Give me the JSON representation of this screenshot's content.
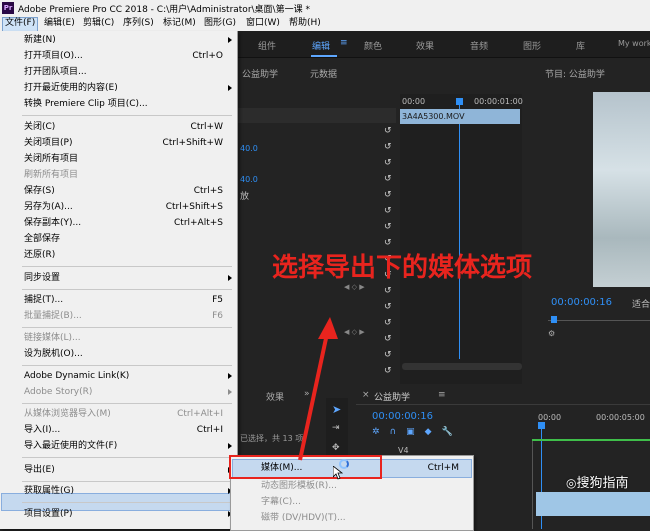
{
  "window": {
    "title": "Adobe Premiere Pro CC 2018 - C:\\用户\\Administrator\\桌面\\第一课 *",
    "app_icon": "Pr"
  },
  "menubar": [
    "文件(F)",
    "编辑(E)",
    "剪辑(C)",
    "序列(S)",
    "标记(M)",
    "图形(G)",
    "窗口(W)",
    "帮助(H)"
  ],
  "workspaces": [
    "组件",
    "编辑",
    "颜色",
    "效果",
    "音频",
    "图形",
    "库",
    "My work"
  ],
  "panels": {
    "source_tabs": [
      "公益助学",
      "元数据"
    ],
    "ec_time_start": "00:00",
    "ec_time_end": "00:00:01:00",
    "clip_name": "3A4A5300.MOV",
    "ec_values": [
      "40.0",
      "40.0"
    ],
    "ec_label_partial": "放",
    "program_title": "节目: 公益助学",
    "program_timecode": "00:00:00:16",
    "program_fit": "适合",
    "effects_tab": "效果",
    "selection_info": "已选择，共 13 项",
    "timeline_title": "公益助学",
    "timeline_timecode": "00:00:00:16",
    "timeline_ruler": [
      "00:00",
      "00:00:05:00"
    ],
    "track_label": "V4"
  },
  "file_menu": [
    {
      "label": "新建(N)",
      "arrow": true
    },
    {
      "label": "打开项目(O)...",
      "shortcut": "Ctrl+O"
    },
    {
      "label": "打开团队项目..."
    },
    {
      "label": "打开最近使用的内容(E)",
      "arrow": true
    },
    {
      "label": "转换 Premiere Clip 项目(C)..."
    },
    {
      "label": "关闭(C)",
      "shortcut": "Ctrl+W"
    },
    {
      "label": "关闭项目(P)",
      "shortcut": "Ctrl+Shift+W"
    },
    {
      "label": "关闭所有项目"
    },
    {
      "label": "刷新所有项目",
      "disabled": true
    },
    {
      "label": "保存(S)",
      "shortcut": "Ctrl+S"
    },
    {
      "label": "另存为(A)...",
      "shortcut": "Ctrl+Shift+S"
    },
    {
      "label": "保存副本(Y)...",
      "shortcut": "Ctrl+Alt+S"
    },
    {
      "label": "全部保存"
    },
    {
      "label": "还原(R)"
    },
    {
      "label": "同步设置",
      "arrow": true
    },
    {
      "label": "捕捉(T)...",
      "shortcut": "F5"
    },
    {
      "label": "批量捕捉(B)...",
      "shortcut": "F6",
      "disabled": true
    },
    {
      "label": "链接媒体(L)...",
      "disabled": true
    },
    {
      "label": "设为脱机(O)..."
    },
    {
      "label": "Adobe Dynamic Link(K)",
      "arrow": true
    },
    {
      "label": "Adobe Story(R)",
      "arrow": true,
      "disabled": true
    },
    {
      "label": "从媒体浏览器导入(M)",
      "shortcut": "Ctrl+Alt+I",
      "disabled": true
    },
    {
      "label": "导入(I)...",
      "shortcut": "Ctrl+I"
    },
    {
      "label": "导入最近使用的文件(F)",
      "arrow": true
    },
    {
      "label": "导出(E)",
      "arrow": true
    },
    {
      "label": "获取属性(G)",
      "arrow": true
    },
    {
      "label": "项目设置(P)",
      "arrow": true
    }
  ],
  "export_submenu": [
    {
      "label": "媒体(M)...",
      "shortcut": "Ctrl+M"
    },
    {
      "label": "动态图形模板(R)...",
      "disabled": true
    },
    {
      "label": "字幕(C)...",
      "disabled": true
    },
    {
      "label": "磁带 (DV/HDV)(T)...",
      "disabled": true
    }
  ],
  "annotation": "选择导出下的媒体选项",
  "watermark": "搜狗指南",
  "colors": {
    "accent_blue": "#2f8ff5",
    "annotation_red": "#e8241e",
    "menu_highlight": "#c5d9ef"
  }
}
